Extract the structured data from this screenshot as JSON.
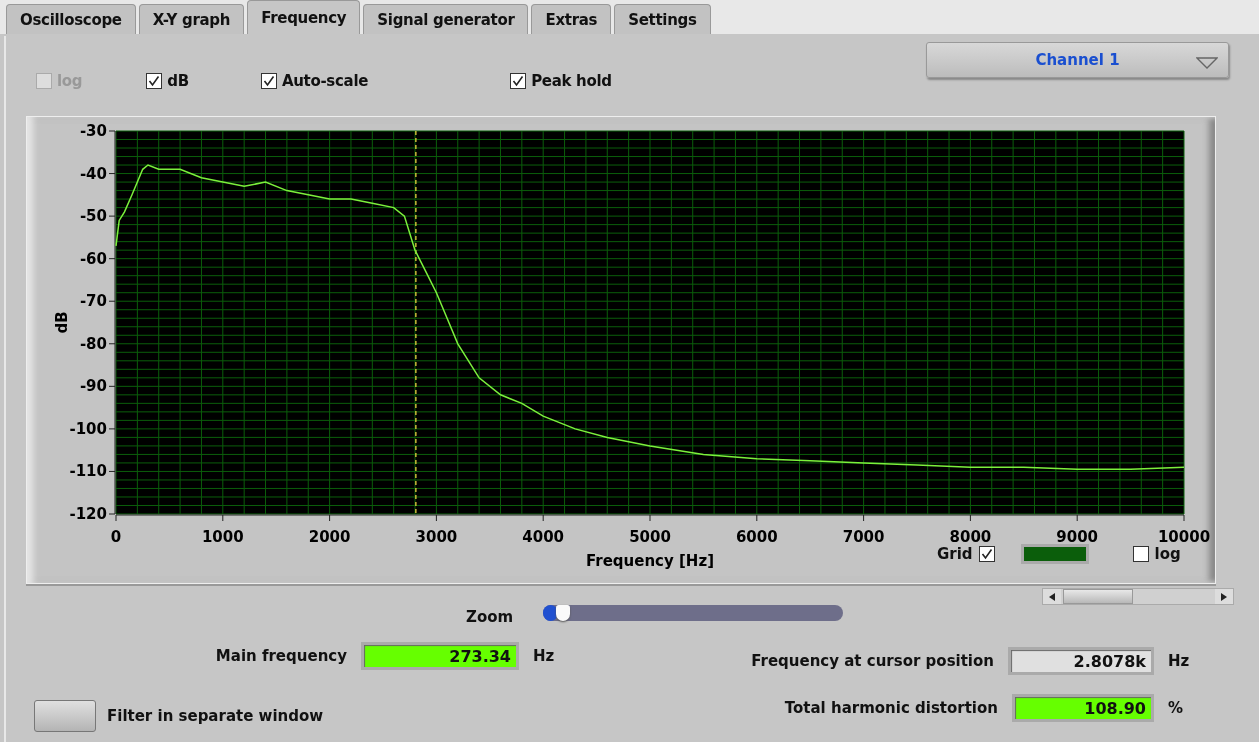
{
  "tabs": [
    {
      "label": "Oscilloscope",
      "selected": false
    },
    {
      "label": "X-Y graph",
      "selected": false
    },
    {
      "label": "Frequency",
      "selected": true
    },
    {
      "label": "Signal generator",
      "selected": false
    },
    {
      "label": "Extras",
      "selected": false
    },
    {
      "label": "Settings",
      "selected": false
    }
  ],
  "options": [
    {
      "label": "log",
      "checked": false,
      "disabled": true
    },
    {
      "label": "dB",
      "checked": true,
      "disabled": false
    },
    {
      "label": "Auto-scale",
      "checked": true,
      "disabled": false
    },
    {
      "label": "Peak hold",
      "checked": true,
      "disabled": false
    }
  ],
  "channel_select": {
    "value": "Channel 1"
  },
  "graph": {
    "grid": {
      "label": "Grid",
      "checked": true,
      "color": "#0b5e0b"
    },
    "log": {
      "label": "log",
      "checked": false
    },
    "chart_data": {
      "type": "line",
      "xlabel": "Frequency [Hz]",
      "ylabel": "dB",
      "xlim": [
        0,
        10000
      ],
      "ylim": [
        -120,
        -30
      ],
      "xticks": [
        0,
        1000,
        2000,
        3000,
        4000,
        5000,
        6000,
        7000,
        8000,
        9000,
        10000
      ],
      "yticks": [
        -120,
        -110,
        -100,
        -90,
        -80,
        -70,
        -60,
        -50,
        -40,
        -30
      ],
      "x": [
        0,
        30,
        80,
        150,
        250,
        300,
        400,
        600,
        800,
        1000,
        1200,
        1400,
        1600,
        1800,
        2000,
        2200,
        2400,
        2600,
        2700,
        2800,
        2900,
        3000,
        3100,
        3200,
        3400,
        3600,
        3800,
        4000,
        4300,
        4600,
        5000,
        5500,
        6000,
        6500,
        7000,
        7500,
        8000,
        8500,
        9000,
        9500,
        10000
      ],
      "grid": true,
      "series": [
        {
          "color": "#7cf03c",
          "values": [
            -57,
            -51,
            -49,
            -45,
            -39,
            -38,
            -39,
            -39,
            -41,
            -42,
            -43,
            -42,
            -44,
            -45,
            -46,
            -46,
            -47,
            -48,
            -50,
            -58,
            -63,
            -68,
            -74,
            -80,
            -88,
            -92,
            -94,
            -97,
            -100,
            -102,
            -104,
            -106,
            -107,
            -107.5,
            -108,
            -108.5,
            -109,
            -109,
            -109.5,
            -109.5,
            -109
          ]
        }
      ],
      "ref_lines": [
        {
          "axis": "x",
          "value": 2807.8
        }
      ]
    }
  },
  "zoom": {
    "label": "Zoom",
    "level": 0.05
  },
  "main_frequency": {
    "label": "Main frequency",
    "value": "273.34",
    "unit": "Hz"
  },
  "cursor_frequency": {
    "label": "Frequency at cursor position",
    "value": "2.8078k",
    "unit": "Hz"
  },
  "thd": {
    "label": "Total harmonic distortion",
    "value": "108.90",
    "unit": "%"
  },
  "filter_button": {
    "label": "Filter in separate window"
  }
}
